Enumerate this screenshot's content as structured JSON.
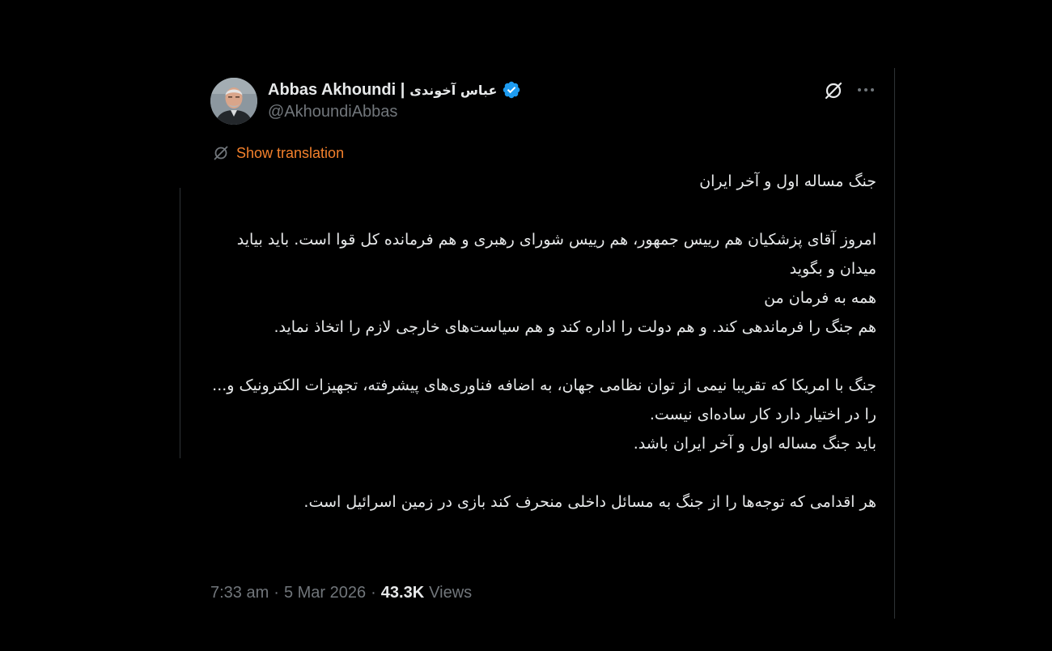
{
  "author": {
    "display_name": "Abbas Akhoundi |",
    "display_name_fa": "عباس آخوندی",
    "handle": "@AkhoundiAbbas",
    "verified": true,
    "verified_color": "#1d9bf0"
  },
  "actions": {
    "grok_icon": "grok-icon",
    "more_icon": "more-icon"
  },
  "translation": {
    "label": "Show translation",
    "color": "#f4812c"
  },
  "tweet": {
    "line1": "جنگ مساله اول و آخر ایران",
    "line2": "امروز آقای پزشکیان هم رییس جمهور، هم رییس شورای رهبری و هم فرمانده کل قوا است. باید بیاید میدان و بگوید",
    "line3": "همه به فرمان من",
    "line4": "هم جنگ را فرماندهی کند. و هم دولت را اداره کند و هم سیاست‌های خارجی لازم را اتخاذ نماید.",
    "line5": "جنگ با امریکا که تقریبا نیمی از توان نظامی جهان، به اضافه فناوری‌های پیشرفته، تجهیزات الکترونیک و... را در اختیار دارد کار ساده‌ای نیست.",
    "line6": "باید جنگ مساله اول و آخر ایران باشد.",
    "line7": "هر اقدامی که توجه‌ها را از جنگ به مسائل داخلی منحرف کند بازی در زمین اسرائیل است."
  },
  "meta": {
    "time": "7:33 am",
    "date": "5 Mar 2026",
    "views_count": "43.3K",
    "views_label": "Views",
    "separator": "·"
  }
}
